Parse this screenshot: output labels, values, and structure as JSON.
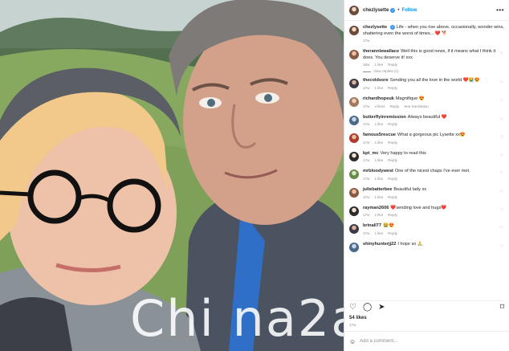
{
  "watermark": "Chi na2a",
  "post": {
    "username": "chezlysette",
    "follow_label": "Follow",
    "more_label": "•••",
    "caption": "Life - when you rise above, occasionally, wonder wins, shattering even the worst of times... ❤️ 🐕",
    "caption_age": "17w"
  },
  "comments": [
    {
      "user": "therannlewallace",
      "text": "Well this is good news, if it means what I think it does. You deserve it! xxx",
      "age": "16w",
      "likes": "1 like",
      "reply": "Reply",
      "view_replies": "View replies (1)"
    },
    {
      "user": "thecoldsore",
      "text": "Sending you all the love in the world ❤️😭😍",
      "age": "17w",
      "likes": "1 like",
      "reply": "Reply"
    },
    {
      "user": "richardhopeuk",
      "text": "Magnifique 😍",
      "age": "17w",
      "likes": "4 likes",
      "reply": "Reply",
      "translate": "See translation"
    },
    {
      "user": "butterflyinremission",
      "text": "Always beautiful ❤️",
      "age": "17w",
      "likes": "1 like",
      "reply": "Reply"
    },
    {
      "user": "famous5rescue",
      "text": "What a gorgeous pic Lysette xx😍",
      "age": "17w",
      "likes": "1 like",
      "reply": "Reply"
    },
    {
      "user": "kpt_mc",
      "text": "Very happy to read this",
      "age": "17w",
      "likes": "1 like",
      "reply": "Reply"
    },
    {
      "user": "mrbloodywest",
      "text": "One of the nicest chaps I've ever met.",
      "age": "17w",
      "likes": "1 like",
      "reply": "Reply"
    },
    {
      "user": "juliebatterbee",
      "text": "Beautiful lady xx",
      "age": "17w",
      "likes": "1 like",
      "reply": "Reply"
    },
    {
      "user": "rayman2606",
      "text": "❤️sending love and hugs❤️",
      "age": "17w",
      "likes": "1 like",
      "reply": "Reply"
    },
    {
      "user": "brinall77",
      "text": "😭😍",
      "age": "17w",
      "likes": "1 like",
      "reply": "Reply"
    },
    {
      "user": "shinyhunterjj22",
      "text": "I hope so 🙏",
      "age": "",
      "likes": "",
      "reply": ""
    }
  ],
  "footer": {
    "likes_count": "54",
    "likes_suffix": "likes",
    "date": "17w",
    "comment_placeholder": "Add a comment...",
    "post_label": "Post"
  },
  "icons": {
    "like": "♡",
    "comment": "◯",
    "share": "➤",
    "save": "⌑",
    "emoji": "☺",
    "verified": "✓",
    "heart": "♡"
  }
}
